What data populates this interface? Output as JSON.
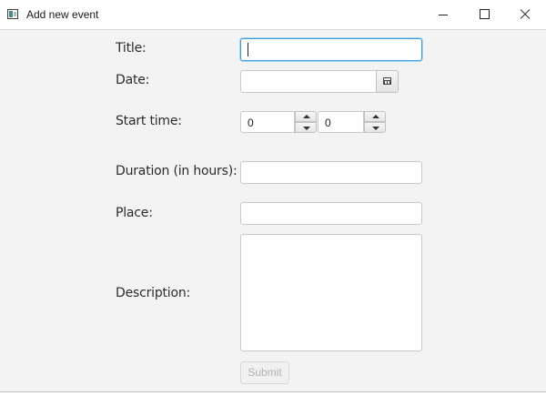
{
  "window": {
    "title": "Add new event",
    "icon": "app-window-icon",
    "controls": [
      "minimize",
      "maximize",
      "close"
    ]
  },
  "form": {
    "title_label": "Title:",
    "title_value": "",
    "date_label": "Date:",
    "date_value": "",
    "date_picker_icon": "calendar-icon",
    "start_time_label": "Start time:",
    "start_hour": "0",
    "start_minute": "0",
    "duration_label": "Duration (in hours):",
    "duration_value": "",
    "place_label": "Place:",
    "place_value": "",
    "description_label": "Description:",
    "description_value": "",
    "submit_label": "Submit",
    "submit_enabled": false
  },
  "colors": {
    "focus_border": "#3ea0d6",
    "background": "#f3f3f3"
  }
}
